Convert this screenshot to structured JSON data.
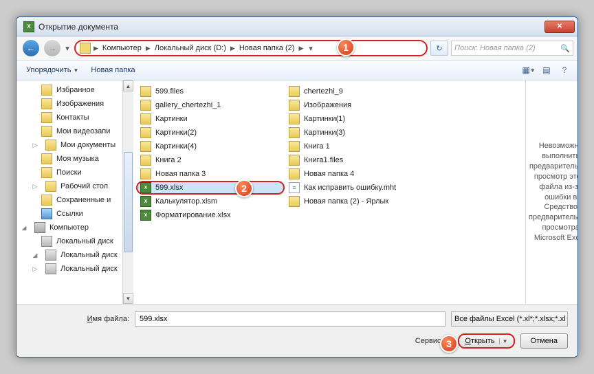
{
  "titlebar": {
    "title": "Открытие документа"
  },
  "nav": {
    "breadcrumbs": [
      "Компьютер",
      "Локальный диск (D:)",
      "Новая папка (2)"
    ],
    "search_placeholder": "Поиск: Новая папка (2)"
  },
  "toolbar": {
    "organize": "Упорядочить",
    "newfolder": "Новая папка"
  },
  "sidebar": {
    "items": [
      {
        "label": "Избранное",
        "icon": "folder",
        "l": 1
      },
      {
        "label": "Изображения",
        "icon": "folder",
        "l": 1
      },
      {
        "label": "Контакты",
        "icon": "folder",
        "l": 1
      },
      {
        "label": "Мои видеозапи",
        "icon": "folder",
        "l": 1
      },
      {
        "label": "Мои документы",
        "icon": "folder",
        "l": 1,
        "arrow": "▷"
      },
      {
        "label": "Моя музыка",
        "icon": "folder",
        "l": 1
      },
      {
        "label": "Поиски",
        "icon": "search",
        "l": 1
      },
      {
        "label": "Рабочий стол",
        "icon": "folder",
        "l": 1,
        "arrow": "▷"
      },
      {
        "label": "Сохраненные и",
        "icon": "folder",
        "l": 1
      },
      {
        "label": "Ссылки",
        "icon": "link",
        "l": 1
      },
      {
        "label": "Компьютер",
        "icon": "comp",
        "l": 0,
        "arrow": "◢"
      },
      {
        "label": "Локальный диск",
        "icon": "drive",
        "l": 1
      },
      {
        "label": "Локальный диск",
        "icon": "drive",
        "l": 1,
        "arrow": "◢"
      },
      {
        "label": "Локальный диск",
        "icon": "drive",
        "l": 1,
        "arrow": "▷"
      }
    ]
  },
  "files": {
    "col1": [
      {
        "name": "599.files",
        "icon": "folder"
      },
      {
        "name": "gallery_chertezhi_1",
        "icon": "folder"
      },
      {
        "name": "Картинки",
        "icon": "folder"
      },
      {
        "name": "Картинки(2)",
        "icon": "folder"
      },
      {
        "name": "Картинки(4)",
        "icon": "folder"
      },
      {
        "name": "Книга 2",
        "icon": "folder"
      },
      {
        "name": "Новая папка 3",
        "icon": "folder"
      },
      {
        "name": "599.xlsx",
        "icon": "excel",
        "selected": true
      },
      {
        "name": "Калькулятор.xlsm",
        "icon": "excel"
      },
      {
        "name": "Форматирование.xlsx",
        "icon": "excel"
      }
    ],
    "col2": [
      {
        "name": "chertezhi_9",
        "icon": "folder"
      },
      {
        "name": "Изображения",
        "icon": "folder"
      },
      {
        "name": "Картинки(1)",
        "icon": "folder"
      },
      {
        "name": "Картинки(3)",
        "icon": "folder"
      },
      {
        "name": "Книга 1",
        "icon": "folder"
      },
      {
        "name": "Книга1.files",
        "icon": "folder"
      },
      {
        "name": "Новая папка 4",
        "icon": "folder"
      },
      {
        "name": "Как исправить ошибку.mht",
        "icon": "mht"
      },
      {
        "name": "Новая папка (2) - Ярлык",
        "icon": "short"
      }
    ]
  },
  "preview": {
    "text": "Невозможно выполнить предварительный просмотр этого файла из-за ошибки в Средство предварительного просмотра Microsoft Excel."
  },
  "bottom": {
    "filename_label": "Имя файла:",
    "filename_value": "599.xlsx",
    "filter": "Все файлы Excel (*.xl*;*.xlsx;*.xl",
    "tools": "Сервис",
    "open": "Открыть",
    "cancel": "Отмена"
  },
  "callouts": {
    "c1": "1",
    "c2": "2",
    "c3": "3"
  }
}
